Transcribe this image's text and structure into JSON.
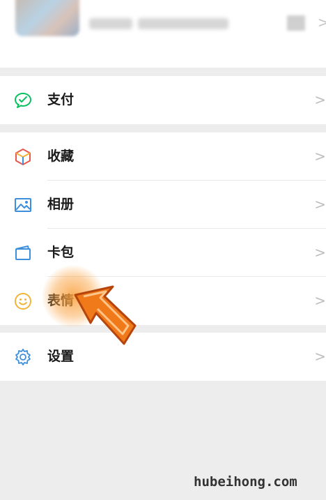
{
  "menu": {
    "pay": {
      "label": "支付",
      "icon": "wechat-pay-icon"
    },
    "favorites": {
      "label": "收藏",
      "icon": "cube-icon"
    },
    "album": {
      "label": "相册",
      "icon": "image-icon"
    },
    "cards": {
      "label": "卡包",
      "icon": "wallet-icon"
    },
    "stickers": {
      "label": "表情",
      "icon": "smiley-icon"
    },
    "settings": {
      "label": "设置",
      "icon": "gear-icon"
    },
    "chevron": ">"
  },
  "watermark": "hubeihong.com",
  "colors": {
    "background": "#ededed",
    "pay_green": "#07c160",
    "icon_blue": "#3d8fdc",
    "arrow_orange": "#f07a1a"
  }
}
